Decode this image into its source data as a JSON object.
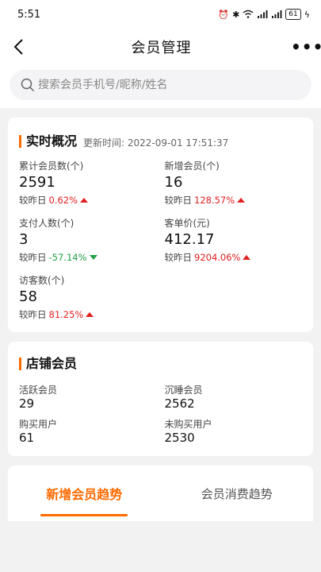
{
  "status_bar": {
    "time": "5:51",
    "network": "⁴ᴳ",
    "battery": "61"
  },
  "nav": {
    "title": "会员管理",
    "more": "•••"
  },
  "search": {
    "placeholder": "搜索会员手机号/昵称/姓名"
  },
  "overview": {
    "title": "实时概况",
    "update_time": "更新时间:  2022-09-01 17:51:37",
    "compare_label": "较昨日",
    "stats": [
      {
        "label": "累计会员数(个)",
        "value": "2591",
        "change": "0.62%",
        "trend": "up"
      },
      {
        "label": "新增会员(个)",
        "value": "16",
        "change": "128.57%",
        "trend": "up"
      },
      {
        "label": "支付人数(个)",
        "value": "3",
        "change": "-57.14%",
        "trend": "down"
      },
      {
        "label": "客单价(元)",
        "value": "412.17",
        "change": "9204.06%",
        "trend": "up"
      },
      {
        "label": "访客数(个)",
        "value": "58",
        "change": "81.25%",
        "trend": "up"
      }
    ]
  },
  "store_members": {
    "title": "店铺会员",
    "items": [
      {
        "label": "活跃会员",
        "value": "29"
      },
      {
        "label": "沉睡会员",
        "value": "2562"
      },
      {
        "label": "购买用户",
        "value": "61"
      },
      {
        "label": "未购买用户",
        "value": "2530"
      }
    ]
  },
  "tabs": [
    {
      "label": "新增会员趋势",
      "active": true
    },
    {
      "label": "会员消费趋势",
      "active": false
    }
  ],
  "colors": {
    "accent": "#ff6a00",
    "up": "#e02020",
    "down": "#22a047"
  }
}
